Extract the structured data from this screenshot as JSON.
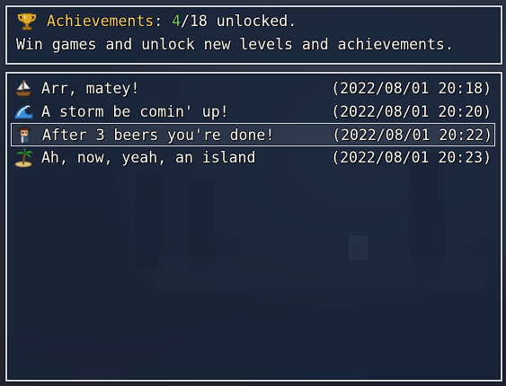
{
  "header": {
    "label": "Achievements",
    "colon": ":",
    "unlocked_count": "4",
    "total_text": "/18 unlocked.",
    "description": "Win games and unlock new levels and achievements."
  },
  "achievements": [
    {
      "name": "Arr, matey!",
      "date": "(2022/08/01 20:18)",
      "icon": "ship-icon"
    },
    {
      "name": "A storm be comin' up!",
      "date": "(2022/08/01 20:20)",
      "icon": "wave-icon"
    },
    {
      "name": "After 3 beers you're done!",
      "date": "(2022/08/01 20:22)",
      "icon": "pirate-icon"
    },
    {
      "name": "Ah, now, yeah, an island",
      "date": "(2022/08/01 20:23)",
      "icon": "palm-tree-icon"
    }
  ],
  "selected_index": 2,
  "colors": {
    "label": "#ffd65a",
    "count": "#6fd35a",
    "text": "#ffffff",
    "window": "#18243a"
  }
}
